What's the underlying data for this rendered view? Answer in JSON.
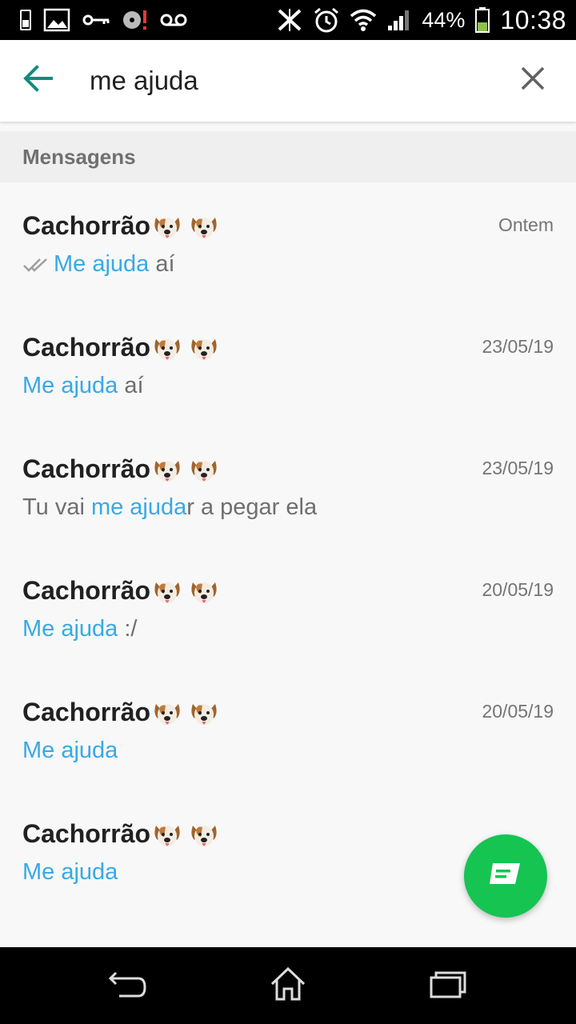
{
  "status_bar": {
    "time": "10:38",
    "battery_percent": "44%",
    "battery_level": 0.44,
    "icons_left": [
      "sim-icon",
      "image-icon",
      "key-icon",
      "sd-error-icon",
      "voicemail-icon"
    ],
    "icons_right": [
      "no-nfc-icon",
      "alarm-icon",
      "wifi-icon",
      "signal-icon",
      "battery-icon"
    ]
  },
  "search": {
    "query": "me ajuda"
  },
  "section": {
    "title": "Mensagens"
  },
  "results": [
    {
      "name": "Cachorrão",
      "date": "Ontem",
      "read_ticks": true,
      "snippet": [
        {
          "t": "Me ajuda",
          "h": true
        },
        {
          "t": " aí",
          "h": false
        }
      ]
    },
    {
      "name": "Cachorrão",
      "date": "23/05/19",
      "read_ticks": false,
      "snippet": [
        {
          "t": "Me ajuda",
          "h": true
        },
        {
          "t": " aí",
          "h": false
        }
      ]
    },
    {
      "name": "Cachorrão",
      "date": "23/05/19",
      "read_ticks": false,
      "snippet": [
        {
          "t": "Tu vai ",
          "h": false
        },
        {
          "t": "me ajuda",
          "h": true
        },
        {
          "t": "r a pegar ela",
          "h": false
        }
      ]
    },
    {
      "name": "Cachorrão",
      "date": "20/05/19",
      "read_ticks": false,
      "snippet": [
        {
          "t": "Me ajuda",
          "h": true
        },
        {
          "t": " :/",
          "h": false
        }
      ]
    },
    {
      "name": "Cachorrão",
      "date": "20/05/19",
      "read_ticks": false,
      "snippet": [
        {
          "t": "Me ajuda",
          "h": true
        }
      ]
    },
    {
      "name": "Cachorrão",
      "date": "",
      "read_ticks": false,
      "snippet": [
        {
          "t": "Me ajuda",
          "h": true
        }
      ]
    }
  ],
  "colors": {
    "accent": "#128c7e",
    "highlight": "#38a9e6",
    "fab": "#16c452"
  }
}
